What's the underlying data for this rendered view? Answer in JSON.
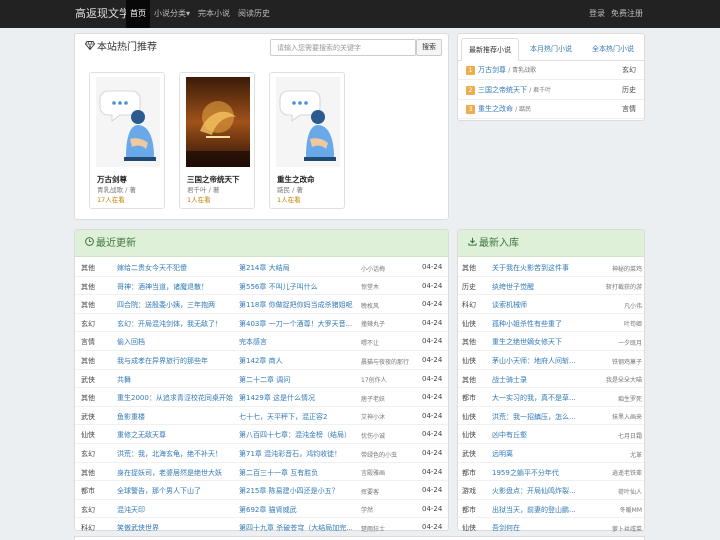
{
  "navbar": {
    "brand": "高返现文学",
    "nav_items": [
      {
        "label": "首页",
        "active": true
      },
      {
        "label": "小说分类▾",
        "active": false
      },
      {
        "label": "完本小说",
        "active": false
      },
      {
        "label": "阅读历史",
        "active": false
      }
    ],
    "right_items": [
      "登录",
      "免费注册"
    ]
  },
  "hot": {
    "title": "本站热门推荐",
    "icon": "diamond-icon",
    "search_placeholder": "请输入您需要搜索的关键字",
    "search_button": "搜索",
    "books": [
      {
        "title": "万古剑尊",
        "author": "青乳战歌 / 著",
        "readers": "17人在看",
        "cover": "placeholder"
      },
      {
        "title": "三国之帝统天下",
        "author": "君千叶 / 著",
        "readers": "1人在看",
        "cover": "image"
      },
      {
        "title": "重生之改命",
        "author": "踮民 / 著",
        "readers": "1人在看",
        "cover": "placeholder"
      }
    ]
  },
  "rank": {
    "tabs": [
      "最新推荐小说",
      "本月热门小说",
      "全本热门小说"
    ],
    "items": [
      {
        "num": "1",
        "title": "万古剑尊",
        "author": "/ 青乳战歌",
        "genre": "玄幻"
      },
      {
        "num": "2",
        "title": "三国之帝统天下",
        "author": "/ 君千叶",
        "genre": "历史"
      },
      {
        "num": "3",
        "title": "重生之改命",
        "author": "/ 踮民",
        "genre": "言情"
      }
    ]
  },
  "latest": {
    "title": "最近更新",
    "icon": "clock-icon",
    "rows": [
      {
        "genre": "其他",
        "book": "嫁给二贵女今天不犯傻",
        "chapter": "第214章 大结局",
        "author": "小小话梅",
        "date": "04-24"
      },
      {
        "genre": "其他",
        "book": "哥神：酒神当道，诸魔退散！",
        "chapter": "第556章 不叫儿子叫什么",
        "author": "惊堂木",
        "date": "04-24"
      },
      {
        "genre": "其他",
        "book": "四合院：送殷委小姨，三年抱两",
        "chapter": "第118章 你做捉把你妈当成杀猪姐呢",
        "author": "晚枚风",
        "date": "04-24"
      },
      {
        "genre": "玄幻",
        "book": "玄幻：开局混沌剑体，我无敌了！",
        "chapter": "第403章 一刀一个酒尊！大罗天音...",
        "author": "撞辣丸子",
        "date": "04-24"
      },
      {
        "genre": "言情",
        "book": "偷入回档",
        "chapter": "完本感言",
        "author": "喂不让",
        "date": "04-24"
      },
      {
        "genre": "其他",
        "book": "我与成孝在异界旅行的那些年",
        "chapter": "第142章 商人",
        "author": "晨猫与夜夜的那行",
        "date": "04-24"
      },
      {
        "genre": "武侠",
        "book": "共舞",
        "chapter": "第二十二章 调问",
        "author": "17创作人",
        "date": "04-24"
      },
      {
        "genre": "其他",
        "book": "重生2000：从追求青涩校花同桌开始",
        "chapter": "第1429章 这是什么情况",
        "author": "痞子老妖",
        "date": "04-24"
      },
      {
        "genre": "武侠",
        "book": "鱼影重楼",
        "chapter": "七十七，天平秤下，混正容2",
        "author": "艾神小沐",
        "date": "04-24"
      },
      {
        "genre": "仙侠",
        "book": "重修之无敌天尊",
        "chapter": "第八百四十七章：混沌金榜（结局）",
        "author": "忧伤小诚",
        "date": "04-24"
      },
      {
        "genre": "玄幻",
        "book": "洪荒：我，北海玄龟，绝不补天！",
        "chapter": "第71章 混沌彩音石，鸿钧收徒！",
        "author": "带绿色的小虫",
        "date": "04-24"
      },
      {
        "genre": "其他",
        "book": "身在捉妖司，老婆居然是绝世大妖",
        "chapter": "第二百三十一章 互有胜负",
        "author": "言殿雅画",
        "date": "04-24"
      },
      {
        "genre": "都市",
        "book": "全球警告，那个男人下山了",
        "chapter": "第215章 陈易建小四还是小五？",
        "author": "挥要客",
        "date": "04-24"
      },
      {
        "genre": "玄幻",
        "book": "混沌天印",
        "chapter": "第692章 猫肾威武",
        "author": "学然",
        "date": "04-24"
      },
      {
        "genre": "科幻",
        "book": "笑傲武侠世界",
        "chapter": "第四十九章 杀破苍穹（大结局加完...",
        "author": "楚雨狂士",
        "date": "04-24"
      }
    ]
  },
  "newbooks": {
    "title": "最新入库",
    "icon": "download-icon",
    "rows": [
      {
        "genre": "其他",
        "book": "关于我在火影苦到这件事",
        "author": "神秘的菜鸡"
      },
      {
        "genre": "历史",
        "book": "纨绔世子觉醒",
        "author": "斩打截获的游"
      },
      {
        "genre": "科幻",
        "book": "谈索机械师",
        "author": "凡小伟"
      },
      {
        "genre": "仙侠",
        "book": "孤种小姐杀性有些重了",
        "author": "叶苟卿"
      },
      {
        "genre": "其他",
        "book": "重生之绝世嫡女修天下",
        "author": "一夕既月"
      },
      {
        "genre": "仙侠",
        "book": "茅山小天师：地府人间斩...",
        "author": "铁钢鸡菓子"
      },
      {
        "genre": "其他",
        "book": "战士骑士录",
        "author": "我是朵朵大喵"
      },
      {
        "genre": "都市",
        "book": "大一实习的我，真不是草...",
        "author": "痴生罗死"
      },
      {
        "genre": "仙侠",
        "book": "洪荒：我一招鎮压，怎么...",
        "author": "抹黑入画来"
      },
      {
        "genre": "仙侠",
        "book": "凶中有丘壑",
        "author": "七月日霜"
      },
      {
        "genre": "武侠",
        "book": "远明离",
        "author": "尤革"
      },
      {
        "genre": "都市",
        "book": "1959之躺平不分年代",
        "author": "逍遥老铁辈"
      },
      {
        "genre": "游戏",
        "book": "火影盘点：开局仙鸣炸裂...",
        "author": "荷叶仙人"
      },
      {
        "genre": "都市",
        "book": "出狱当天，前妻的登山鹏...",
        "author": "冬暖MM"
      },
      {
        "genre": "仙侠",
        "book": "吾剑何在",
        "author": "萝卜丝咸菜"
      }
    ]
  },
  "colors": {
    "navbar": "#222222",
    "green_header": "#dff0d8",
    "link": "#337ab7",
    "badge": "#f0ad4e"
  }
}
